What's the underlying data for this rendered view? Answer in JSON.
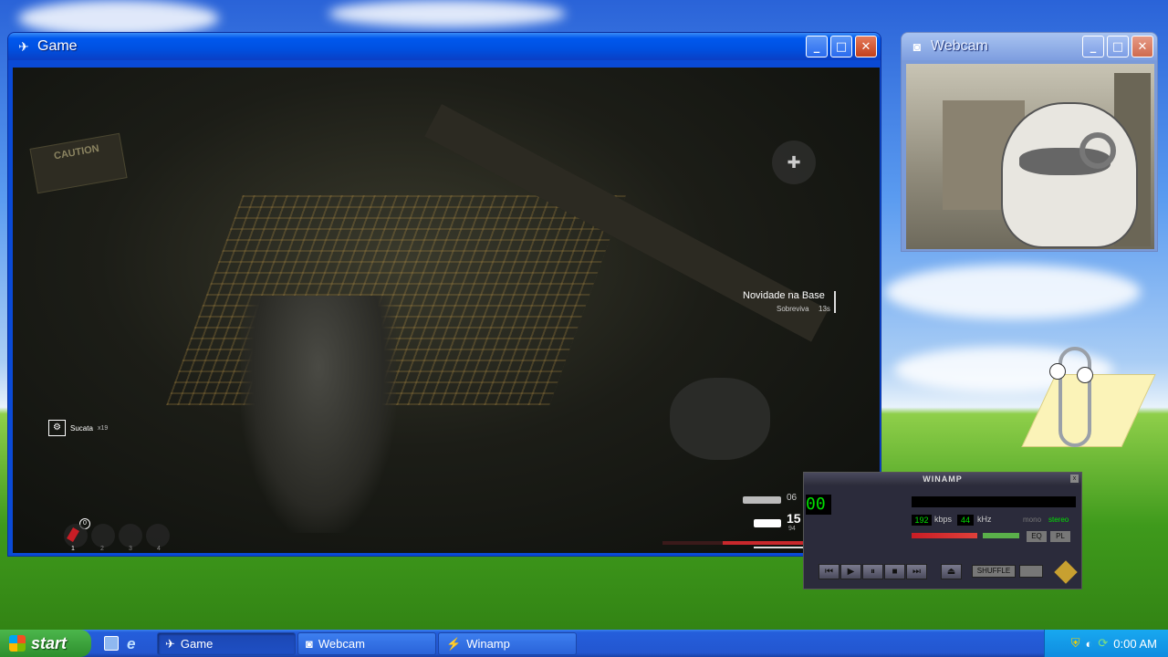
{
  "windows": {
    "game": {
      "title": "Game"
    },
    "webcam": {
      "title": "Webcam"
    },
    "winamp": {
      "title": "WINAMP",
      "time": "00",
      "kbps_value": "192",
      "kbps_label": "kbps",
      "khz_value": "44",
      "khz_label": "kHz",
      "mono": "mono",
      "stereo": "stereo",
      "eq_label": "EQ",
      "pl_label": "PL",
      "shuffle_label": "SHUFFLE"
    }
  },
  "game_hud": {
    "objective_title": "Novidade na Base",
    "objective_sub": "Sobreviva",
    "objective_timer": "13s",
    "item_name": "Sucata",
    "item_count": "x19",
    "secondary_ammo": "06",
    "primary_ammo": "15",
    "reserve_ammo": "94",
    "quick_count": "0",
    "slots": [
      "1",
      "2",
      "3",
      "4"
    ],
    "caution_text": "CAUTION"
  },
  "taskbar": {
    "start_label": "start",
    "tasks": [
      {
        "label": "Game"
      },
      {
        "label": "Webcam"
      },
      {
        "label": "Winamp"
      }
    ],
    "clock": "0:00 AM"
  }
}
